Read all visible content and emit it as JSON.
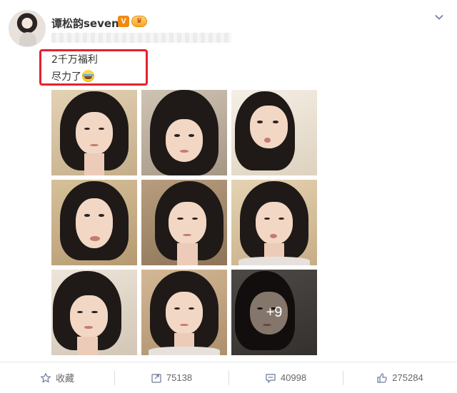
{
  "post": {
    "username": "谭松韵seven",
    "verified_badge": "V",
    "level_badge_icon": "vip-crown-icon",
    "text_line1": "2千万福利",
    "text_line2": "尽力了",
    "emoji": "laughing-crying-emoji",
    "highlight_color": "#e5212d"
  },
  "gallery": {
    "photos": [
      {
        "index": 1,
        "tone": "#d9c6a6"
      },
      {
        "index": 2,
        "tone": "#bfb3a4"
      },
      {
        "index": 3,
        "tone": "#efe6d8"
      },
      {
        "index": 4,
        "tone": "#c9b28c"
      },
      {
        "index": 5,
        "tone": "#a98f70"
      },
      {
        "index": 6,
        "tone": "#d8c4a2"
      },
      {
        "index": 7,
        "tone": "#e4dacb"
      },
      {
        "index": 8,
        "tone": "#c8ab8a"
      },
      {
        "index": 9,
        "tone": "#6f6a66"
      }
    ],
    "more_count_label": "+9"
  },
  "actions": {
    "favorite": {
      "label": "收藏",
      "icon": "star-icon"
    },
    "repost": {
      "count": "75138",
      "icon": "share-icon"
    },
    "comment": {
      "count": "40998",
      "icon": "comment-icon"
    },
    "like": {
      "count": "275284",
      "icon": "thumbs-up-icon"
    }
  },
  "colors": {
    "verified": "#f08a12",
    "text": "#333333",
    "muted": "#666666"
  }
}
